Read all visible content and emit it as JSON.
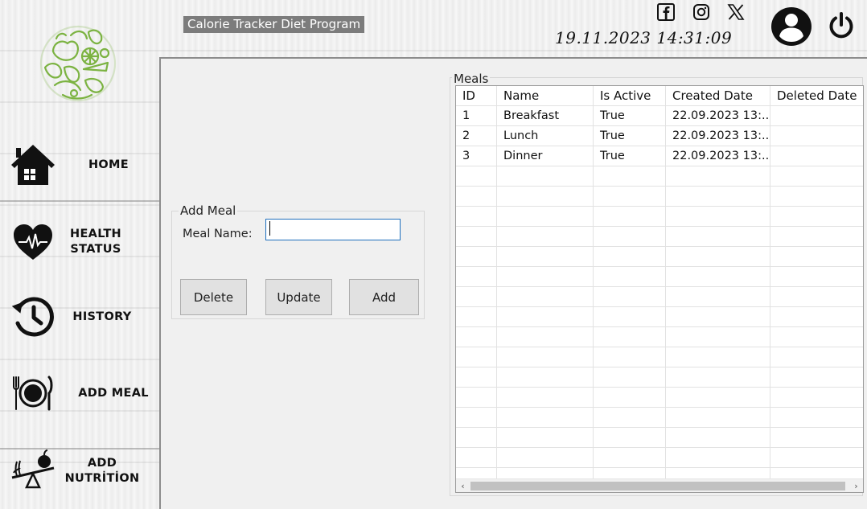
{
  "header": {
    "app_title": "Calorie Tracker Diet Program",
    "datetime": "19.11.2023 14:31:09",
    "social": [
      "facebook-icon",
      "instagram-icon",
      "x-twitter-icon"
    ]
  },
  "sidebar": {
    "items": [
      {
        "label": "HOME",
        "icon": "home-icon"
      },
      {
        "label": "HEALTH\nSTATUS",
        "icon": "heart-pulse-icon"
      },
      {
        "label": "HISTORY",
        "icon": "history-icon"
      },
      {
        "label": "ADD MEAL",
        "icon": "plate-cutlery-icon"
      },
      {
        "label": "ADD\nNUTRİTİON",
        "icon": "nutrition-scale-icon"
      }
    ]
  },
  "add_meal": {
    "group_title": "Add Meal",
    "meal_name_label": "Meal Name:",
    "meal_name_value": "",
    "delete_label": "Delete",
    "update_label": "Update",
    "add_label": "Add"
  },
  "meals": {
    "group_title": "Meals",
    "columns": [
      "ID",
      "Name",
      "Is Active",
      "Created Date",
      "Deleted Date"
    ],
    "rows": [
      [
        "1",
        "Breakfast",
        "True",
        "22.09.2023 13:...",
        ""
      ],
      [
        "2",
        "Lunch",
        "True",
        "22.09.2023 13:...",
        ""
      ],
      [
        "3",
        "Dinner",
        "True",
        "22.09.2023 13:...",
        ""
      ]
    ]
  },
  "colors": {
    "logo_green": "#7cb342",
    "input_focus": "#1e6fbd"
  }
}
